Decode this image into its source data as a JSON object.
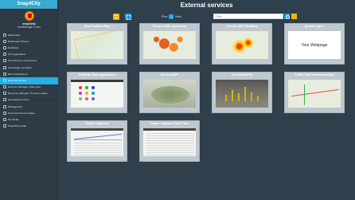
{
  "sidebar": {
    "brand": "Snap4City",
    "org": "snap4city",
    "role": "AreaManager | User",
    "items": [
      {
        "label": "Dashboard",
        "active": false
      },
      {
        "label": "Dashboard Wizard",
        "active": false
      },
      {
        "label": "Notificator",
        "active": false
      },
      {
        "label": "IOT Applications",
        "active": false
      },
      {
        "label": "IOT Directory and Devices",
        "active": false
      },
      {
        "label": "Knowledge and Maps",
        "active": false
      },
      {
        "label": "Micro Applications",
        "active": false
      },
      {
        "label": "External services",
        "active": true
      },
      {
        "label": "Data Set Manager: Data Gate",
        "active": false
      },
      {
        "label": "Resource Manager: Process Loader",
        "active": false
      },
      {
        "label": "Development Tools",
        "active": false
      },
      {
        "label": "Management",
        "active": false
      },
      {
        "label": "Help and Documentation",
        "active": false
      },
      {
        "label": "My Profile",
        "active": false
      },
      {
        "label": "Snap4City portal",
        "active": false
      }
    ]
  },
  "header": {
    "title": "External services"
  },
  "toolbar": {
    "pager_prefix": "Prev",
    "page": "1",
    "pager_suffix": "Next",
    "search_placeholder": "Filter"
  },
  "cards": [
    {
      "title": "Bus Position Map",
      "thumb": "map"
    },
    {
      "title": "Firenze WiFi Clustering",
      "thumb": "dots"
    },
    {
      "title": "Firenze WiFi HeatMap",
      "thumb": "heat"
    },
    {
      "title": "generic open",
      "thumb": "webpage",
      "thumb_text": "Your Webpage"
    },
    {
      "title": "KM4City Web Application",
      "thumb": "km"
    },
    {
      "title": "ServiceMAP",
      "thumb": "aerial"
    },
    {
      "title": "ServiceMAP3D",
      "thumb": "city3d"
    },
    {
      "title": "Traffic Flow Reconstruction",
      "thumb": "traffic"
    },
    {
      "title": "Twitter Vigilance",
      "thumb": "twitter"
    },
    {
      "title": "Twitter Vigilance Real Time",
      "thumb": "twitter"
    }
  ],
  "colors": {
    "accent": "#23b1e6",
    "brand": "#3aa9cf",
    "sidebar_bg": "#2e3b46",
    "content_bg": "#2f3f4b"
  }
}
